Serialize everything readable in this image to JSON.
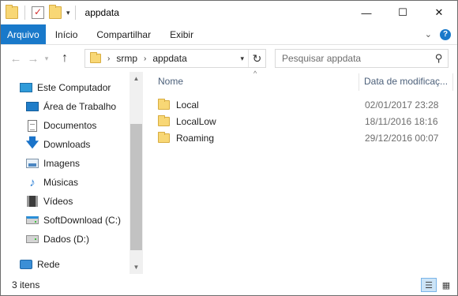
{
  "window": {
    "title": "appdata",
    "controls": {
      "minimize": "—",
      "maximize": "☐",
      "close": "✕"
    }
  },
  "ribbon": {
    "tabs": [
      "Arquivo",
      "Início",
      "Compartilhar",
      "Exibir"
    ],
    "collapse_icon": "chevron-down",
    "help": "?"
  },
  "address": {
    "back": "←",
    "forward": "→",
    "recent": "▾",
    "up": "↑",
    "crumbs": [
      "srmp",
      "appdata"
    ],
    "crumb_separator": "›",
    "search_placeholder": "Pesquisar appdata",
    "refresh": "↻",
    "dropdown": "▾",
    "search_icon": "⚲"
  },
  "nav": {
    "items": [
      {
        "label": "Este Computador",
        "icon": "computer-icon"
      },
      {
        "label": "Área de Trabalho",
        "icon": "desktop-icon"
      },
      {
        "label": "Documentos",
        "icon": "documents-icon"
      },
      {
        "label": "Downloads",
        "icon": "downloads-icon",
        "glyph": "🡇"
      },
      {
        "label": "Imagens",
        "icon": "pictures-icon"
      },
      {
        "label": "Músicas",
        "icon": "music-icon",
        "glyph": "♪"
      },
      {
        "label": "Vídeos",
        "icon": "videos-icon"
      },
      {
        "label": "SoftDownload (C:)",
        "icon": "windows-drive-icon"
      },
      {
        "label": "Dados (D:)",
        "icon": "drive-icon"
      },
      {
        "label": "Rede",
        "icon": "network-icon"
      }
    ]
  },
  "scrollbar": {
    "up": "▲",
    "down": "▼"
  },
  "content": {
    "columns": {
      "name": "Nome",
      "date": "Data de modificaç...",
      "sort_indicator": "^"
    },
    "files": [
      {
        "name": "Local",
        "date": "02/01/2017 23:28"
      },
      {
        "name": "LocalLow",
        "date": "18/11/2016 18:16"
      },
      {
        "name": "Roaming",
        "date": "29/12/2016 00:07"
      }
    ]
  },
  "status": {
    "count": "3 itens",
    "view_details": "☰",
    "view_icons": "▦"
  },
  "colors": {
    "accent": "#1979ca",
    "folder": "#f8d775"
  }
}
